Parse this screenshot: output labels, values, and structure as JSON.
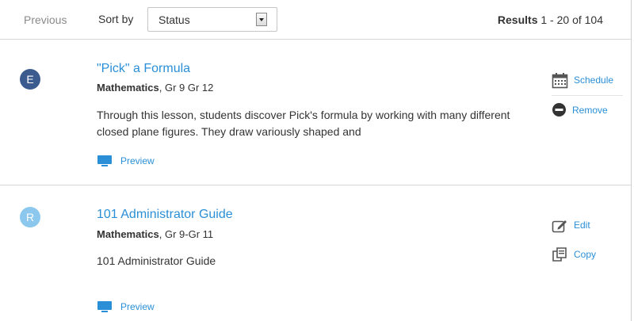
{
  "header": {
    "previous_label": "Previous",
    "sort_label": "Sort by",
    "sort_select": {
      "value": "Status"
    },
    "results": {
      "label": "Results",
      "range": "1 - 20 of 104"
    }
  },
  "results_list": [
    {
      "avatar_letter": "E",
      "avatar_color": "#3b5b8e",
      "title": "\"Pick\" a Formula",
      "subject": "Mathematics",
      "grades": ", Gr 9 Gr 12",
      "description": "Through this lesson, students discover Pick's formula by working with many different closed plane figures. They draw variously shaped and",
      "preview_label": "Preview",
      "actions": [
        {
          "label": "Schedule",
          "icon": "calendar-icon"
        },
        {
          "label": "Remove",
          "icon": "minus-circle-icon"
        }
      ]
    },
    {
      "avatar_letter": "R",
      "avatar_color": "#8cc8ee",
      "title": "101 Administrator Guide",
      "subject": "Mathematics",
      "grades": ", Gr 9-Gr 11",
      "description": "101 Administrator Guide",
      "preview_label": "Preview",
      "actions": [
        {
          "label": "Edit",
          "icon": "edit-icon"
        },
        {
          "label": "Copy",
          "icon": "copy-icon"
        }
      ]
    }
  ],
  "colors": {
    "link": "#2a8fd6",
    "divider": "#d6d6d6"
  }
}
